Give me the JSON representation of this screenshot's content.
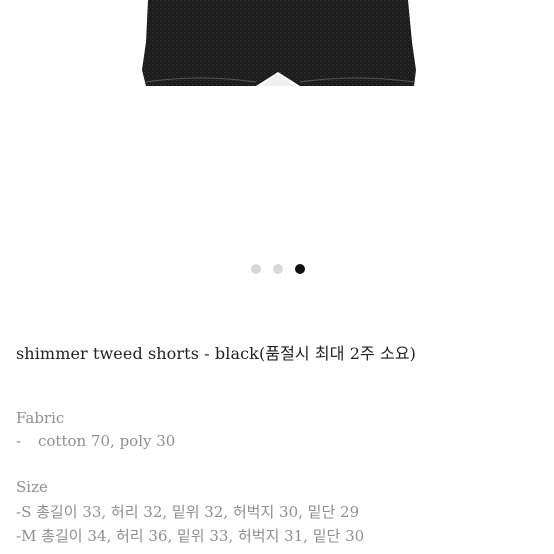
{
  "product": {
    "title": "shimmer tweed shorts - black(품절시 최대 2주 소요)",
    "image": {
      "garment_color": "#1c1c1c",
      "depicts": "shorts-photo"
    }
  },
  "carousel": {
    "total": 3,
    "active_index": 3
  },
  "fabric": {
    "label": "Fabric",
    "bullet": "-",
    "value": "cotton 70, poly 30"
  },
  "size": {
    "label": "Size",
    "lines": [
      "-S 총길이 33, 허리 32, 밑위 32, 허벅지 30, 밑단 29",
      "-M 총길이 34, 허리 36, 밑위 33, 허벅지 31, 밑단 30"
    ]
  },
  "colors": {
    "dot_inactive": "#d8d8d8",
    "dot_active": "#111111",
    "title_text": "#222222",
    "info_text": "#8f8f8f"
  }
}
